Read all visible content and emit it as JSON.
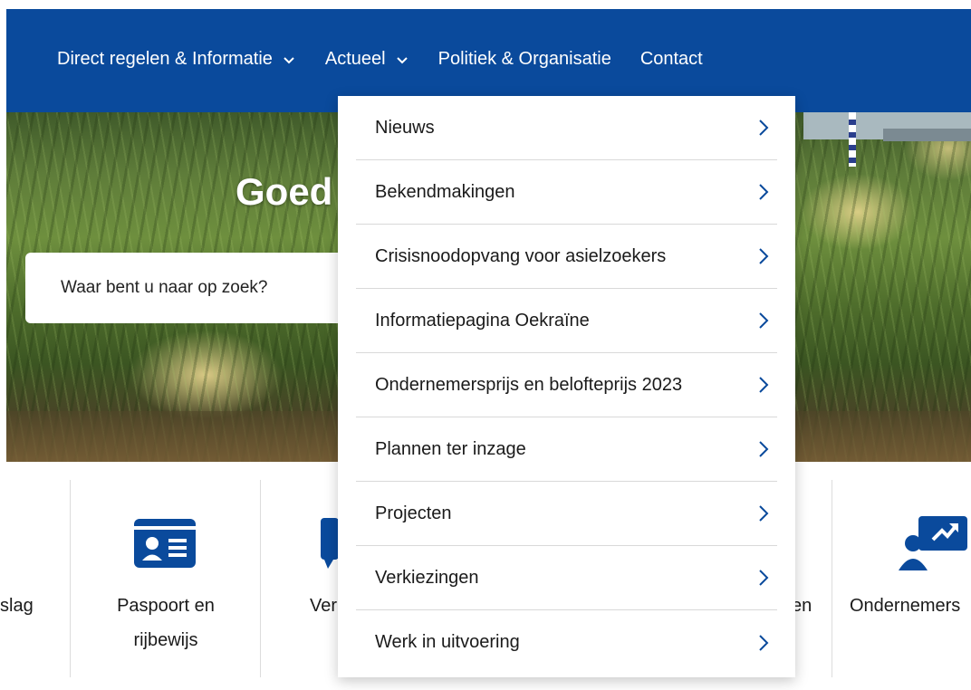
{
  "nav": {
    "items": [
      {
        "label": "Direct regelen & Informatie",
        "has_dropdown": true,
        "icon": "chevron-down-icon"
      },
      {
        "label": "Actueel",
        "has_dropdown": true,
        "icon": "chevron-down-icon"
      },
      {
        "label": "Politiek & Organisatie",
        "has_dropdown": false
      },
      {
        "label": "Contact",
        "has_dropdown": false
      }
    ]
  },
  "hero": {
    "title": "Goed",
    "search_placeholder": "Waar bent u naar op zoek?"
  },
  "dropdown": {
    "parent": "Actueel",
    "items": [
      {
        "label": "Nieuws",
        "icon": "chevron-right-icon"
      },
      {
        "label": "Bekendmakingen",
        "icon": "chevron-right-icon"
      },
      {
        "label": "Crisisnoodopvang voor asielzoekers",
        "icon": "chevron-right-icon"
      },
      {
        "label": "Informatiepagina Oekraïne",
        "icon": "chevron-right-icon"
      },
      {
        "label": "Ondernemersprijs en belofteprijs 2023",
        "icon": "chevron-right-icon"
      },
      {
        "label": "Plannen ter inzage",
        "icon": "chevron-right-icon"
      },
      {
        "label": "Projecten",
        "icon": "chevron-right-icon"
      },
      {
        "label": "Verkiezingen",
        "icon": "chevron-right-icon"
      },
      {
        "label": "Werk in uitvoering",
        "icon": "chevron-right-icon"
      }
    ]
  },
  "tiles": {
    "left_partial": "slag",
    "passport": {
      "line1": "Paspoort en",
      "line2": "rijbewijs",
      "icon": "id-card-icon"
    },
    "middle_partial": "Ver",
    "right_partial": "en",
    "entrepreneurs": {
      "label": "Ondernemers",
      "icon": "presenter-icon"
    }
  },
  "colors": {
    "nav_bg": "#0a4a9c",
    "icon_blue": "#0a4a9c",
    "dropdown_bg": "#ffffff",
    "divider": "#d9d9d9"
  }
}
